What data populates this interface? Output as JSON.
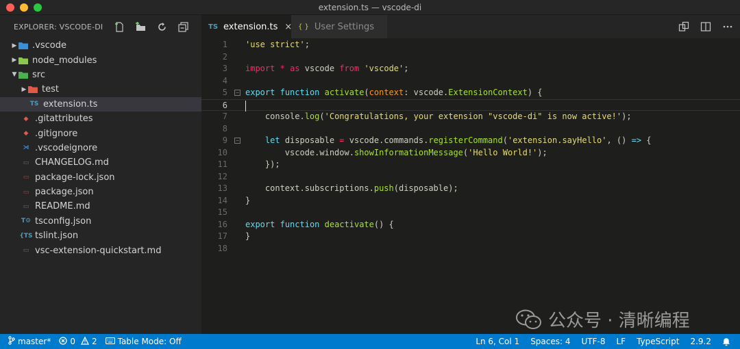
{
  "window": {
    "title": "extension.ts — vscode-di"
  },
  "explorer": {
    "title": "EXPLORER: VSCODE-DI",
    "items": [
      {
        "caret": "▶",
        "icon_text": "",
        "icon": "folder-vscode-icon",
        "label": ".vscode",
        "color": "#3b8fd6"
      },
      {
        "caret": "▶",
        "icon_text": "",
        "icon": "folder-node-icon",
        "label": "node_modules",
        "color": "#8cc84b"
      },
      {
        "caret": "▼",
        "icon_text": "",
        "icon": "folder-src-icon",
        "label": "src",
        "color": "#4caf50"
      },
      {
        "caret": "▶",
        "icon_text": "",
        "icon": "folder-test-icon",
        "label": "test",
        "color": "#e05a47"
      },
      {
        "caret": "",
        "icon_text": "TS",
        "icon": "typescript-file-icon",
        "label": "extension.ts",
        "color": "#519aba"
      },
      {
        "caret": "",
        "icon_text": "◆",
        "icon": "git-file-icon",
        "label": ".gitattributes",
        "color": "#e05a47"
      },
      {
        "caret": "",
        "icon_text": "◆",
        "icon": "git-file-icon",
        "label": ".gitignore",
        "color": "#e05a47"
      },
      {
        "caret": "",
        "icon_text": "⋊",
        "icon": "vscode-file-icon",
        "label": ".vscodeignore",
        "color": "#3b8fd6"
      },
      {
        "caret": "",
        "icon_text": "▭",
        "icon": "markdown-file-icon",
        "label": "CHANGELOG.md",
        "color": "#7a6b5a"
      },
      {
        "caret": "",
        "icon_text": "▭",
        "icon": "npm-file-icon",
        "label": "package-lock.json",
        "color": "#cb3837"
      },
      {
        "caret": "",
        "icon_text": "▭",
        "icon": "npm-file-icon",
        "label": "package.json",
        "color": "#cb3837"
      },
      {
        "caret": "",
        "icon_text": "▭",
        "icon": "markdown-file-icon",
        "label": "README.md",
        "color": "#7a6b5a"
      },
      {
        "caret": "",
        "icon_text": "T⚙",
        "icon": "tsconfig-file-icon",
        "label": "tsconfig.json",
        "color": "#519aba"
      },
      {
        "caret": "",
        "icon_text": "{TS",
        "icon": "tslint-file-icon",
        "label": "tslint.json",
        "color": "#519aba"
      },
      {
        "caret": "",
        "icon_text": "▭",
        "icon": "markdown-file-icon",
        "label": "vsc-extension-quickstart.md",
        "color": "#7a6b5a"
      }
    ]
  },
  "tabs": [
    {
      "icon_text": "TS",
      "label": "extension.ts",
      "close": "×",
      "icon_color": "#519aba"
    },
    {
      "icon_text": "{ }",
      "label": "User Settings",
      "icon_color": "#cbcb41"
    }
  ],
  "editor": {
    "lines": [
      {
        "n": "1",
        "html": "<span class='s'>'use strict'</span>;"
      },
      {
        "n": "2",
        "html": ""
      },
      {
        "n": "3",
        "html": "<span class='o'>import</span> <span class='o'>*</span> <span class='o'>as</span> vscode <span class='o'>from</span> <span class='s'>'vscode'</span>;"
      },
      {
        "n": "4",
        "html": ""
      },
      {
        "n": "5",
        "html": "<span class='k'>export</span> <span class='k'>function</span> <span class='f'>activate</span>(<span class='p'>context</span>: vscode.<span class='f'>ExtensionContext</span>) {",
        "fold": true
      },
      {
        "n": "6",
        "html": "",
        "current": true
      },
      {
        "n": "7",
        "html": "    console.<span class='f'>log</span>(<span class='s'>'Congratulations, your extension \"vscode-di\" is now active!'</span>);"
      },
      {
        "n": "8",
        "html": ""
      },
      {
        "n": "9",
        "html": "    <span class='k'>let</span> disposable <span class='o'>=</span> vscode.commands.<span class='f'>registerCommand</span>(<span class='s'>'extension.sayHello'</span>, () <span class='k'>=&gt;</span> {",
        "fold": true
      },
      {
        "n": "10",
        "html": "        vscode.window.<span class='f'>showInformationMessage</span>(<span class='s'>'Hello World!'</span>);"
      },
      {
        "n": "11",
        "html": "    });"
      },
      {
        "n": "12",
        "html": ""
      },
      {
        "n": "13",
        "html": "    context.subscriptions.<span class='f'>push</span>(disposable);"
      },
      {
        "n": "14",
        "html": "}"
      },
      {
        "n": "15",
        "html": ""
      },
      {
        "n": "16",
        "html": "<span class='k'>export</span> <span class='k'>function</span> <span class='f'>deactivate</span>() {"
      },
      {
        "n": "17",
        "html": "}"
      },
      {
        "n": "18",
        "html": ""
      }
    ]
  },
  "watermark": {
    "text": "公众号 · 清晰编程"
  },
  "status": {
    "branch": "master*",
    "errors": "0",
    "warnings": "2",
    "table_mode": "Table Mode: Off",
    "position": "Ln 6, Col 1",
    "spaces": "Spaces: 4",
    "encoding": "UTF-8",
    "eol": "LF",
    "language": "TypeScript",
    "version": "2.9.2"
  },
  "colors": {
    "statusbar": "#007acc",
    "sidebar": "#252526",
    "editor": "#1e1f1c"
  }
}
